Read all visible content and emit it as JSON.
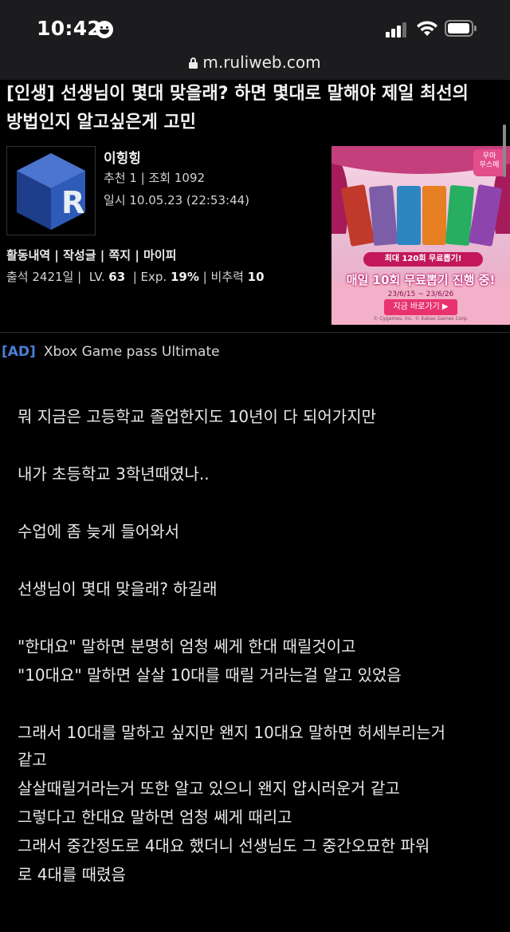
{
  "status_bar": {
    "time": "10:42"
  },
  "browser": {
    "url": "m.ruliweb.com"
  },
  "post": {
    "title_line1": "[인생] 선생님이 몇대 맞을래? 하면 몇대로 말해야 제일 최선의",
    "title_line2": "방법인지 알고싶은게 고민",
    "author": {
      "name": "이힝힝",
      "recommend_views": "추천 1 | 조회 1092",
      "datetime": "일시 10.05.23 (22:53:44)"
    },
    "links": [
      "활동내역",
      "작성글",
      "쪽지",
      "마이피"
    ],
    "stats": {
      "attendance_label": "출석 2421일",
      "lv_label": "LV.",
      "lv_value": "63",
      "exp_label": "Exp.",
      "exp_value": "19%",
      "bichu_label": "비추력",
      "bichu_value": "10"
    },
    "banner": {
      "logo": "우마 무스메",
      "pill": "최대 120회 무료뽑기!",
      "main": "매일 10회 무료뽑기 진행 중!",
      "date": "23/6/15 ~ 23/6/26",
      "cta": "지금 바로가기 ▶",
      "copyright": "© Cygames, Inc. © Kakao Games Corp."
    },
    "ad": {
      "tag": "[AD]",
      "text": "Xbox Game pass Ultimate"
    },
    "body": [
      "뭐 지금은 고등학교 졸업한지도 10년이 다 되어가지만",
      "내가 초등학교 3학년때였나..",
      "수업에 좀 늦게 들어와서",
      "선생님이 몇대 맞을래? 하길래",
      "\"한대요\" 말하면 분명히 엄청 쎄게 한대 때릴것이고",
      "\"10대요\" 말하면 살살 10대를 때릴 거라는걸 알고 있었음",
      "그래서 10대를 말하고 싶지만 왠지 10대요 말하면 허세부리는거",
      "같고",
      "살살때릴거라는거 또한 알고 있으니 왠지 얍시러운거 같고",
      "그렇다고 한대요 말하면 엄청 쎄게 때리고",
      "그래서 중간정도로 4대요 했더니 선생님도 그 중간오묘한 파워",
      "로 4대를 때렸음"
    ]
  }
}
